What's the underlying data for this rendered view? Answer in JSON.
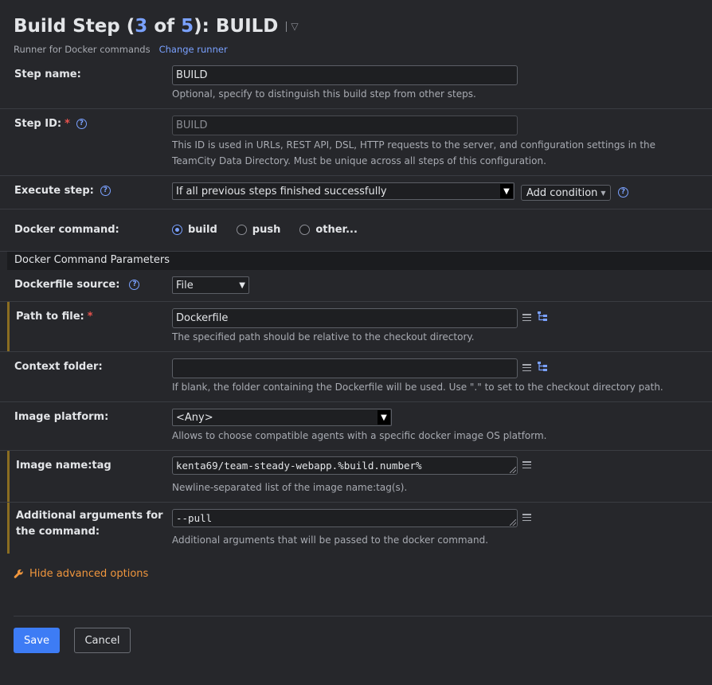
{
  "header": {
    "title_prefix": "Build Step (",
    "step_current": "3",
    "title_of": " of ",
    "step_total": "5",
    "title_suffix": "): BUILD",
    "runner_text": "Runner for Docker commands",
    "change_runner": "Change runner"
  },
  "fields": {
    "step_name": {
      "label": "Step name:",
      "value": "BUILD",
      "note": "Optional, specify to distinguish this build step from other steps."
    },
    "step_id": {
      "label": "Step ID:",
      "required": "*",
      "value": "BUILD",
      "note": "This ID is used in URLs, REST API, DSL, HTTP requests to the server, and configuration settings in the TeamCity Data Directory. Must be unique across all steps of this configuration."
    },
    "execute_step": {
      "label": "Execute step:",
      "value": "If all previous steps finished successfully",
      "add_condition": "Add condition"
    },
    "docker_command": {
      "label": "Docker command:",
      "options": [
        "build",
        "push",
        "other..."
      ],
      "selected": "build"
    },
    "section_title": "Docker Command Parameters",
    "dockerfile_source": {
      "label": "Dockerfile source:",
      "value": "File"
    },
    "path_to_file": {
      "label": "Path to file:",
      "required": "*",
      "value": "Dockerfile",
      "note": "The specified path should be relative to the checkout directory."
    },
    "context_folder": {
      "label": "Context folder:",
      "value": "",
      "note": "If blank, the folder containing the Dockerfile will be used. Use \".\" to set to the checkout directory path."
    },
    "image_platform": {
      "label": "Image platform:",
      "value": "<Any>",
      "note": "Allows to choose compatible agents with a specific docker image OS platform."
    },
    "image_name_tag": {
      "label": "Image name:tag",
      "value": "kenta69/team-steady-webapp.%build.number%",
      "note": "Newline-separated list of the image name:tag(s)."
    },
    "additional_args": {
      "label_line1": "Additional arguments for",
      "label_line2": "the command:",
      "value": "--pull",
      "note": "Additional arguments that will be passed to the docker command."
    }
  },
  "advanced": "Hide advanced options",
  "buttons": {
    "save": "Save",
    "cancel": "Cancel"
  },
  "colors": {
    "accent": "#3d7cf5",
    "link": "#7aa1ff",
    "warning": "#f0963d",
    "required": "#e8534d"
  }
}
